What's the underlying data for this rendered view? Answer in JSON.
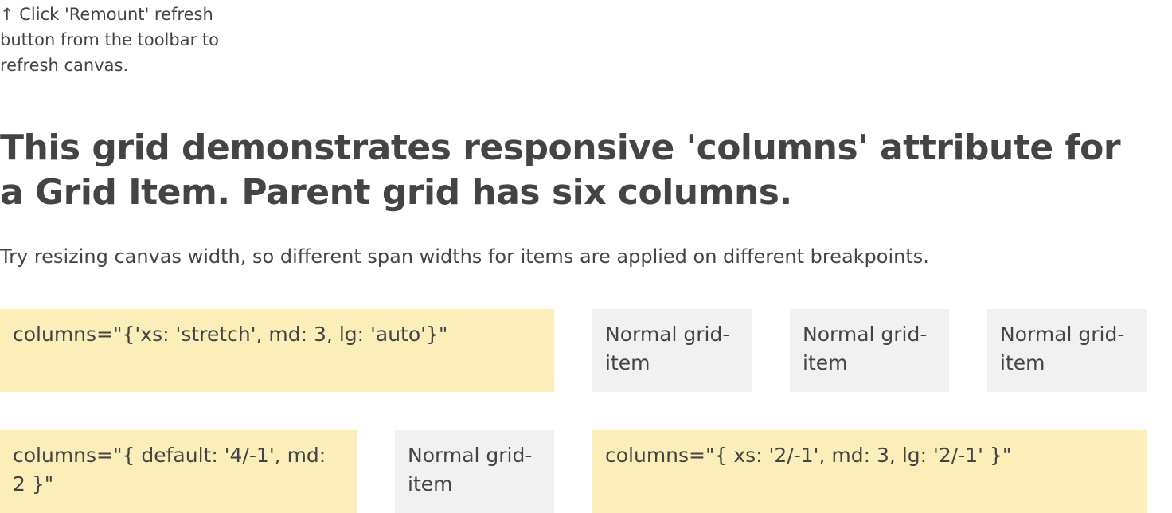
{
  "hint": "↑ Click 'Remount' refresh button from the toolbar to refresh canvas.",
  "heading": "This grid demonstrates responsive 'columns' attribute for a Grid Item. Parent grid has six columns.",
  "lead": "Try resizing canvas width, so different span widths for items are applied on different breakpoints.",
  "grid": {
    "row1": {
      "item1": "columns=\"{'xs: 'stretch', md: 3, lg: 'auto'}\"",
      "item2": "Normal grid-item",
      "item3": "Normal grid-item",
      "item4": "Normal grid-item"
    },
    "row2": {
      "item1": "columns=\"{ default: '4/-1', md: 2 }\"",
      "item2": "Normal grid-item",
      "item3": "columns=\"{ xs: '2/-1', md: 3, lg: '2/-1' }\""
    }
  },
  "colors": {
    "highlight": "#fbeeb8",
    "normal": "#f1f1f1",
    "text": "#444444"
  }
}
